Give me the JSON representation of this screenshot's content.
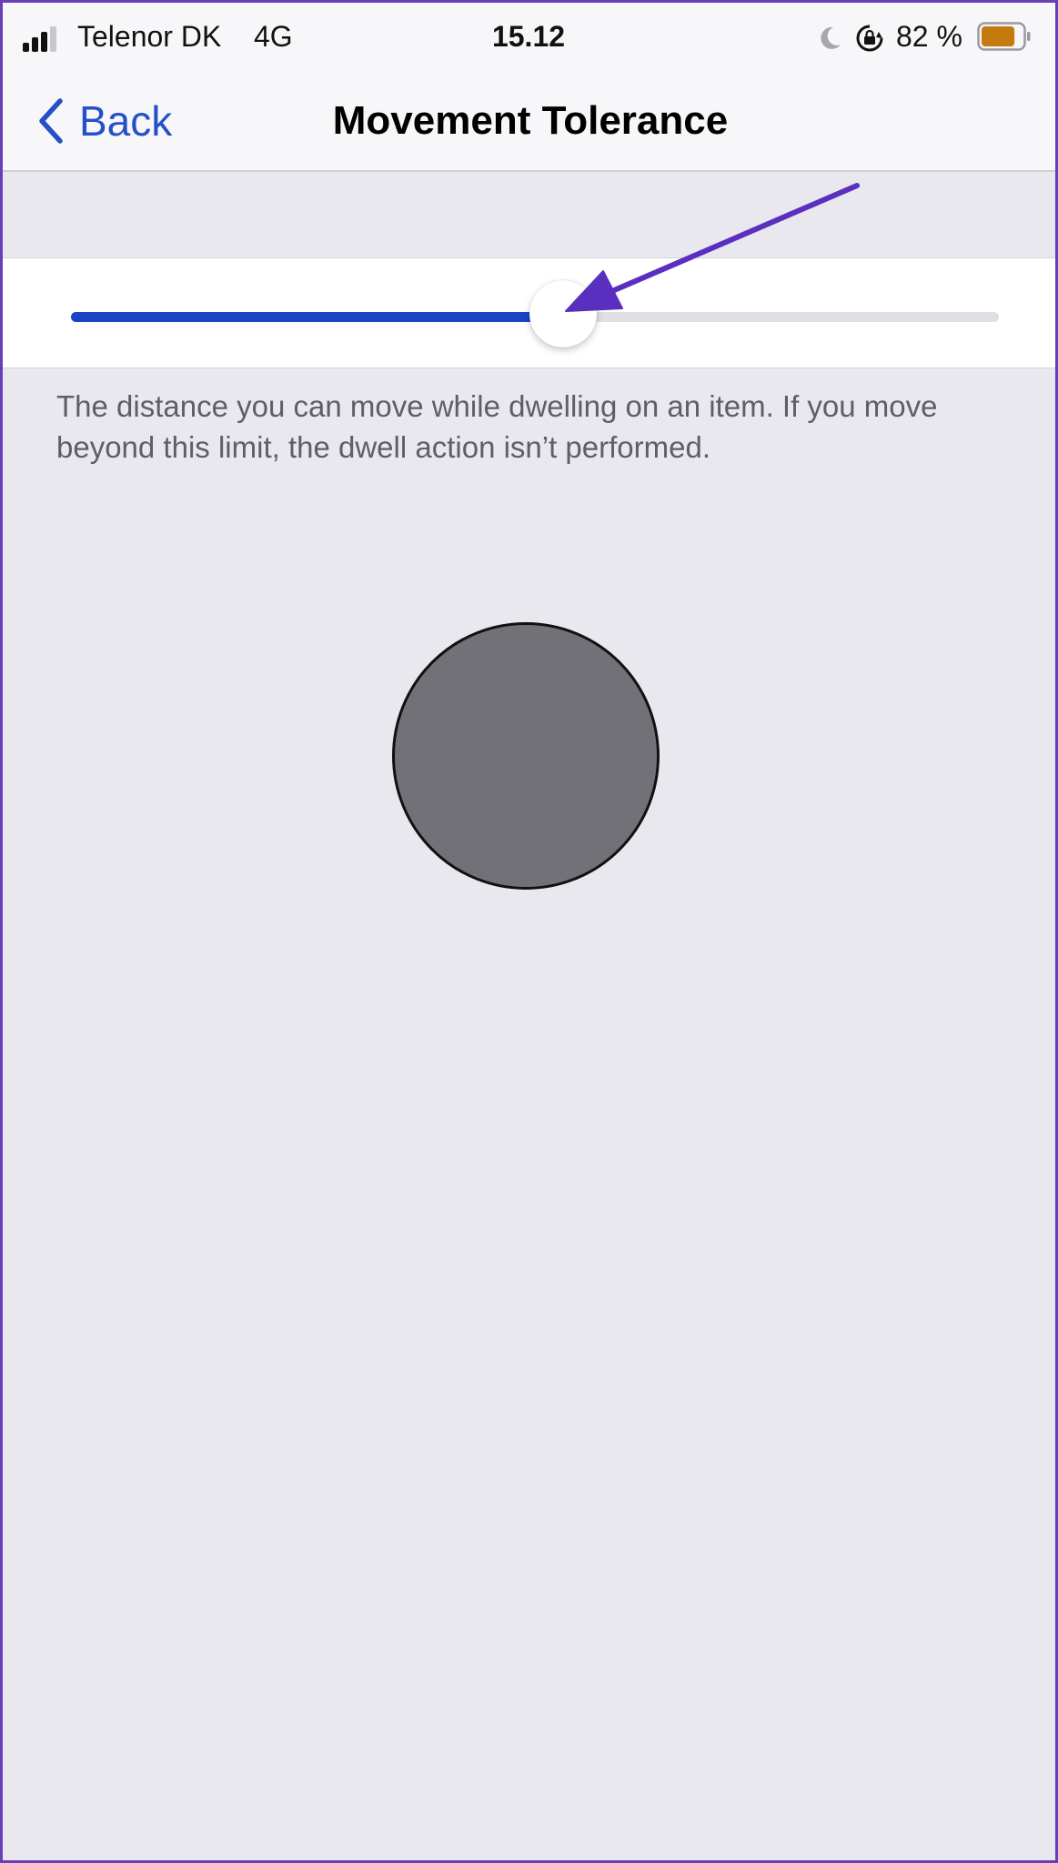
{
  "status_bar": {
    "carrier": "Telenor DK",
    "network": "4G",
    "time": "15.12",
    "battery_percent": "82 %",
    "battery_level": 0.82,
    "battery_color": "#c47a0f",
    "icons": [
      "signal-icon",
      "moon-icon",
      "rotation-lock-icon",
      "battery-icon"
    ]
  },
  "nav": {
    "back_label": "Back",
    "title": "Movement Tolerance"
  },
  "slider": {
    "value": 0.53,
    "fill_color": "#1d43c4"
  },
  "footer": {
    "text": "The distance you can move while dwelling on an item. If you move beyond this limit, the dwell action isn’t performed."
  },
  "colors": {
    "accent": "#2550c7",
    "annotation_arrow": "#5a2fc0",
    "dwell_circle": "#727177"
  }
}
